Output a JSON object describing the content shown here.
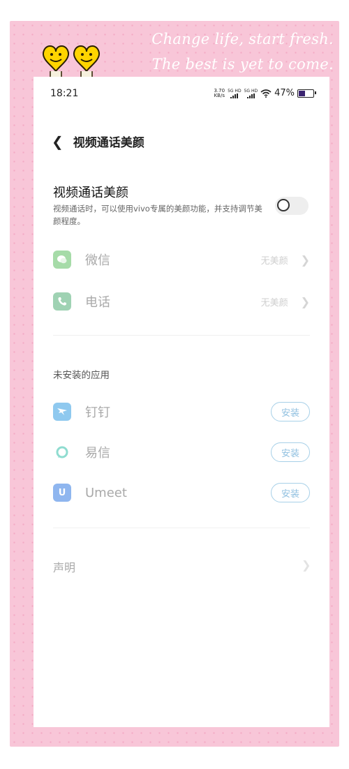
{
  "decor": {
    "quote_line1": "Change life, start fresh.",
    "quote_line2": "The best is yet to come.",
    "hearts_icon": "smiley-hearts-sticker"
  },
  "status_bar": {
    "time": "18:21",
    "net_speed_value": "3.70",
    "net_speed_unit": "KB/s",
    "sim1_label": "5G HD",
    "sim2_label": "5G HD",
    "battery_percent": "47%",
    "battery_level": 0.47
  },
  "nav": {
    "back_icon": "chevron-left-icon",
    "title": "视频通话美颜"
  },
  "beauty_setting": {
    "title": "视频通话美颜",
    "description": "视频通话时，可以使用vivo专属的美颜功能，并支持调节美颜程度。",
    "enabled": false
  },
  "installed_apps": [
    {
      "name": "微信",
      "value": "无美颜",
      "icon": "wechat-icon",
      "color": "#a6dba8"
    },
    {
      "name": "电话",
      "value": "无美颜",
      "icon": "phone-icon",
      "color": "#9fd2b3"
    }
  ],
  "not_installed": {
    "header": "未安装的应用",
    "install_label": "安装",
    "apps": [
      {
        "name": "钉钉",
        "icon": "dingtalk-icon",
        "color": "#8fc9ef"
      },
      {
        "name": "易信",
        "icon": "yixin-icon",
        "color": "#8fdcd0"
      },
      {
        "name": "Umeet",
        "icon": "umeet-icon",
        "color": "#8fb6ef",
        "glyph": "U"
      }
    ]
  },
  "statement": {
    "label": "声明"
  },
  "colors": {
    "frame_pink": "#f8c6d8",
    "install_border": "#a7d0e8",
    "battery_fill": "#3b2470"
  }
}
